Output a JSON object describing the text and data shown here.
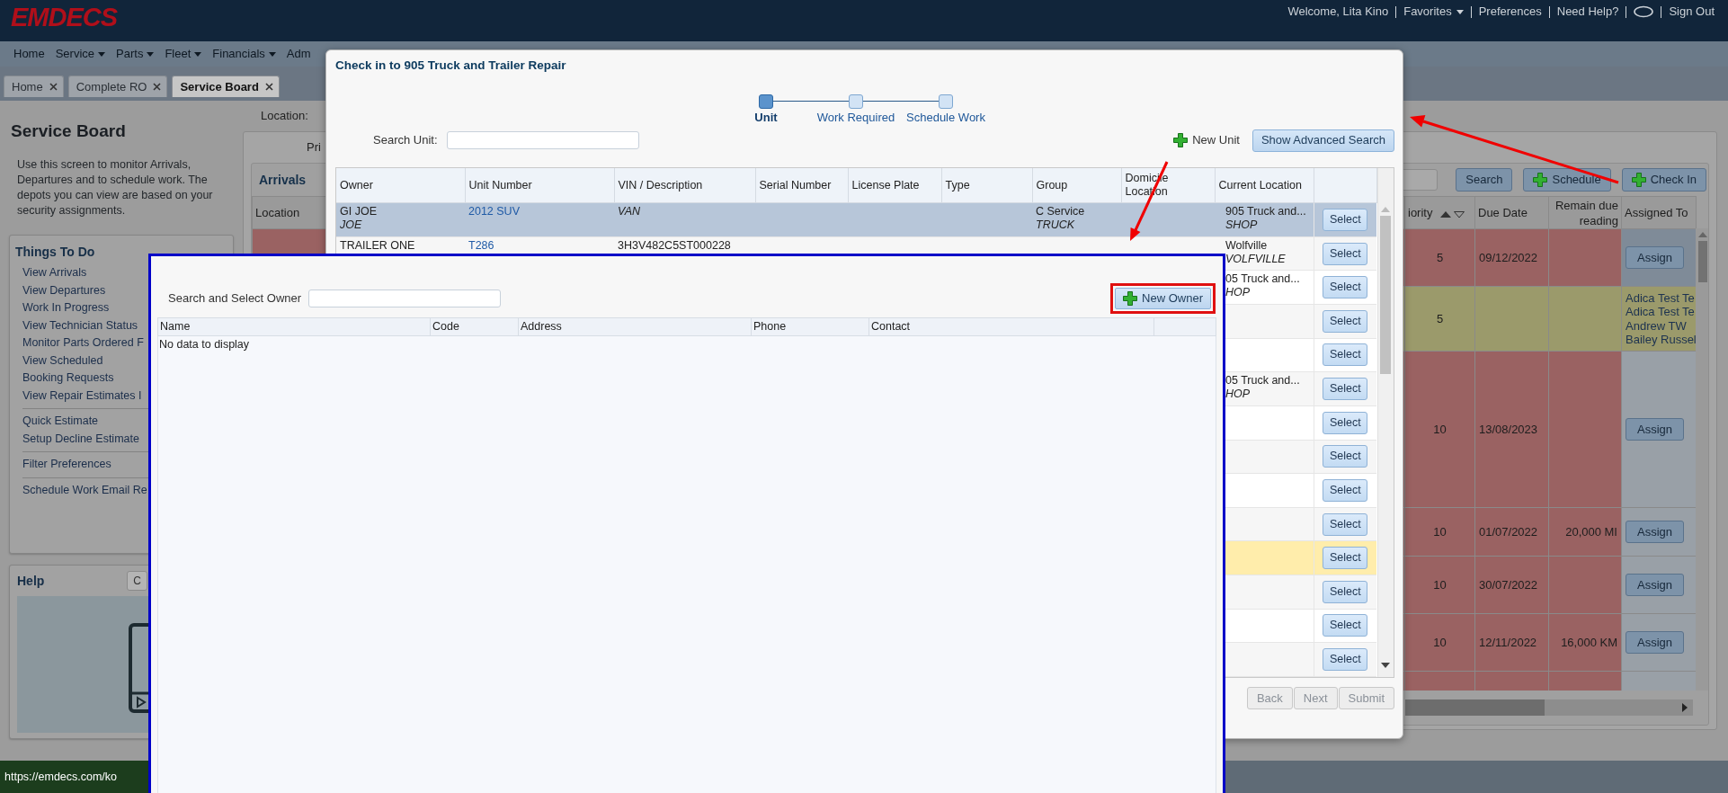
{
  "header": {
    "logo": "EMDECS",
    "links": [
      {
        "kind": "text",
        "label": "Welcome, Lita Kino"
      },
      {
        "kind": "menu",
        "label": "Favorites"
      },
      {
        "kind": "link",
        "label": "Preferences"
      },
      {
        "kind": "link",
        "label": "Need Help?"
      },
      {
        "kind": "icon"
      },
      {
        "kind": "link",
        "label": "Sign Out"
      }
    ]
  },
  "menu": [
    {
      "label": "Home",
      "dropdown": false
    },
    {
      "label": "Service",
      "dropdown": true
    },
    {
      "label": "Parts",
      "dropdown": true
    },
    {
      "label": "Fleet",
      "dropdown": true
    },
    {
      "label": "Financials",
      "dropdown": true
    },
    {
      "label": "Adm",
      "dropdown": false
    }
  ],
  "tabs": [
    {
      "label": "Home",
      "selected": false
    },
    {
      "label": "Complete RO",
      "selected": false
    },
    {
      "label": "Service Board",
      "selected": true
    }
  ],
  "sidebar": {
    "title": "Service Board",
    "description": "Use this screen to monitor Arrivals, Departures and to schedule work. The depots you can view are based on your security assignments.",
    "things_to_do": {
      "title": "Things To Do",
      "groups": [
        [
          "View Arrivals",
          "View Departures",
          "Work In Progress",
          "View Technician Status",
          "Monitor Parts Ordered F",
          "View Scheduled",
          "Booking Requests",
          "View Repair Estimates I"
        ],
        [
          "Quick Estimate",
          "Setup Decline Estimate"
        ],
        [
          "Filter Preferences"
        ],
        [
          "Schedule Work Email Re"
        ]
      ]
    },
    "help": {
      "title": "Help",
      "button": "C"
    }
  },
  "board": {
    "location_label": "Location:",
    "panel_label": "Pri",
    "title": "Arrivals",
    "buttons": [
      {
        "kind": "plain",
        "label": "Search"
      },
      {
        "kind": "add",
        "label": "Schedule"
      },
      {
        "kind": "add",
        "label": "Check In"
      }
    ],
    "columns": [
      {
        "label": "Location"
      },
      {
        "label": "iority",
        "sort_ascending": true
      },
      {
        "label": "Due Date"
      },
      {
        "label": "Remain due reading"
      },
      {
        "label": "Assigned To"
      }
    ],
    "rows": [
      {
        "color": "#9a6262",
        "priority": "5",
        "due_date": "09/12/2022",
        "button": "Assign"
      },
      {
        "color": "#9b9a6b",
        "priority": "5",
        "assigned": [
          "Adica Test Te",
          "Adica Test Te",
          "Andrew TW",
          "Bailey Russel"
        ]
      },
      {
        "color": "#9a6262",
        "priority": "10",
        "due_date": "13/08/2023",
        "button": "Assign"
      },
      {
        "color": "#9a6262",
        "priority": "10",
        "due_date": "01/07/2022",
        "remain": "20,000 MI",
        "button": "Assign"
      },
      {
        "color": "#9a6262",
        "priority": "10",
        "due_date": "30/07/2022",
        "button": "Assign"
      },
      {
        "color": "#9a6262",
        "priority": "10",
        "due_date": "12/11/2022",
        "remain": "16,000 KM",
        "button": "Assign"
      },
      {
        "color": "#9a6262"
      }
    ]
  },
  "dialog": {
    "title": "Check in to 905 Truck and Trailer Repair",
    "steps": [
      {
        "label": "Unit",
        "selected": true
      },
      {
        "label": "Work Required",
        "selected": false
      },
      {
        "label": "Schedule Work",
        "selected": false
      }
    ],
    "search_label": "Search Unit:",
    "new_unit": "New Unit",
    "advanced_button": "Show Advanced Search",
    "columns": [
      "Owner",
      "Unit Number",
      "VIN / Description",
      "Serial Number",
      "License Plate",
      "Type",
      "Group",
      "Domicile Location",
      "Current Location"
    ],
    "rows": [
      {
        "selected": true,
        "highlighted": false,
        "owner": "GI JOE",
        "owner_code": "JOE",
        "unit_number": "2012 SUV",
        "description": "VAN",
        "group": "C Service",
        "group_type": "TRUCK",
        "location": "905 Truck and...",
        "location_code": "SHOP",
        "button": "Select"
      },
      {
        "selected": false,
        "highlighted": false,
        "owner": "TRAILER ONE",
        "unit_number": "T286",
        "vin": "3H3V482C5ST000228",
        "location": "Wolfville",
        "location_code": "VOLFVILLE",
        "button": "Select"
      },
      {
        "selected": false,
        "highlighted": false,
        "location": "05 Truck and...",
        "location_code": "HOP",
        "button": "Select"
      },
      {
        "selected": false,
        "highlighted": false,
        "button": "Select"
      },
      {
        "selected": false,
        "highlighted": false,
        "button": "Select"
      },
      {
        "selected": false,
        "highlighted": false,
        "location": "05 Truck and...",
        "location_code": "HOP",
        "button": "Select"
      },
      {
        "selected": false,
        "highlighted": false,
        "button": "Select"
      },
      {
        "selected": false,
        "highlighted": false,
        "button": "Select"
      },
      {
        "selected": false,
        "highlighted": false,
        "button": "Select"
      },
      {
        "selected": false,
        "highlighted": false,
        "button": "Select"
      },
      {
        "selected": false,
        "highlighted": true,
        "button": "Select"
      },
      {
        "selected": false,
        "highlighted": false,
        "button": "Select"
      },
      {
        "selected": false,
        "highlighted": false,
        "button": "Select"
      },
      {
        "selected": false,
        "highlighted": false,
        "button": "Select"
      }
    ],
    "footer_buttons": [
      {
        "label": "Back",
        "disabled": true
      },
      {
        "label": "Next",
        "disabled": true
      },
      {
        "label": "Submit",
        "disabled": true
      }
    ]
  },
  "owner_popup": {
    "search_label": "Search and Select Owner",
    "new_button": "New Owner",
    "columns": [
      "Name",
      "Code",
      "Address",
      "Phone",
      "Contact"
    ],
    "empty_text": "No data to display"
  },
  "status_bar": {
    "url": "https://emdecs.com/ko"
  }
}
